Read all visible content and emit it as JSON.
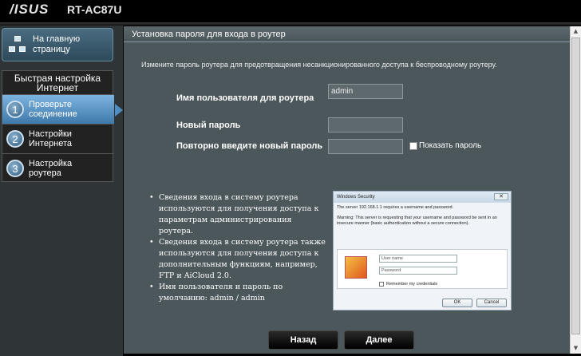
{
  "header": {
    "logo": "/ISUS",
    "model": "RT-AC87U"
  },
  "sidebar": {
    "home_label_line1": "На главную",
    "home_label_line2": "страницу",
    "quick_setup_title_line1": "Быстрая настройка",
    "quick_setup_title_line2": "Интернет",
    "steps": [
      {
        "num": "1",
        "line1": "Проверьте",
        "line2": "соединение",
        "active": true
      },
      {
        "num": "2",
        "line1": "Настройки",
        "line2": "Интернета",
        "active": false
      },
      {
        "num": "3",
        "line1": "Настройка",
        "line2": "роутера",
        "active": false
      }
    ]
  },
  "main": {
    "title": "Установка пароля для входа в роутер",
    "description": "Измените пароль роутера для предотвращения несанкционированного доступа к беспроводному роутеру.",
    "fields": {
      "username_label": "Имя пользователя для роутера",
      "username_value": "admin",
      "new_password_label": "Новый пароль",
      "new_password_value": "",
      "confirm_password_label": "Повторно введите новый пароль",
      "confirm_password_value": "",
      "show_password_label": "Показать пароль"
    },
    "bullets": [
      "Сведения входа в систему роутера используются для получения доступа к параметрам администрирования роутера.",
      "Сведения входа в систему роутера также используются для получения доступа к дополнительным функциям, например, FTP и AiCloud 2.0.",
      "Имя пользователя и пароль по умолчанию: admin / admin"
    ],
    "dialog": {
      "title": "Windows Security",
      "message": "The server 192.168.1.1 requires a username and password.",
      "warning": "Warning: This server is requesting that your username and password be sent in an insecure manner (basic authentication without a secure connection).",
      "username_placeholder": "User name",
      "password_placeholder": "Password",
      "remember_label": "Remember my credentials",
      "ok_label": "OK",
      "cancel_label": "Cancel"
    },
    "buttons": {
      "back": "Назад",
      "next": "Далее"
    }
  },
  "colors": {
    "panel_bg": "#4c575b",
    "sidebar_bg": "#2f3436",
    "active_step": "#5a98cc"
  }
}
